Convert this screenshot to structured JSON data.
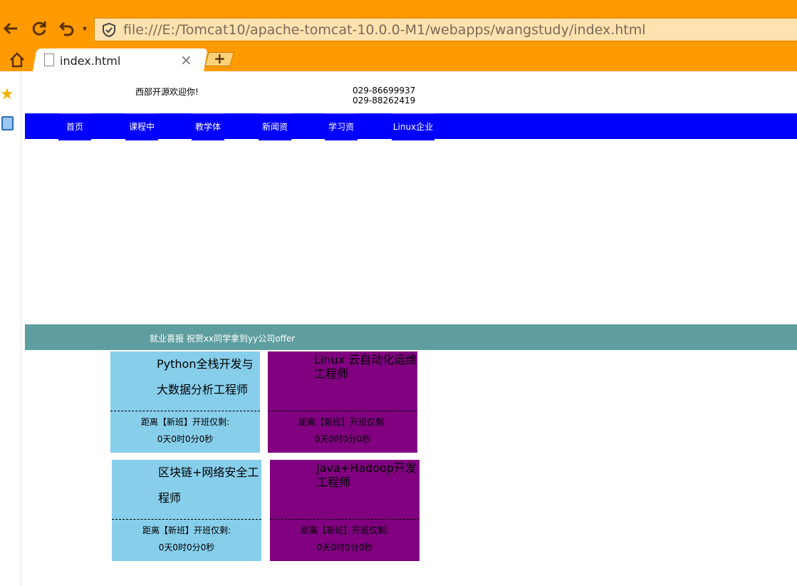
{
  "browser": {
    "url": "file:///E:/Tomcat10/apache-tomcat-10.0.0-M1/webapps/wangstudy/index.html",
    "tab_title": "index.html",
    "new_tab_label": "+",
    "accent_color": "#ff9b00"
  },
  "header": {
    "welcome": "西部开源欢迎你!",
    "phone": "029-86699937 029-88262419"
  },
  "nav": {
    "items": [
      {
        "label": "首页"
      },
      {
        "label": "课程中"
      },
      {
        "label": "教学体"
      },
      {
        "label": "新闻资"
      },
      {
        "label": "学习资"
      },
      {
        "label": "Linux企业"
      }
    ]
  },
  "banner": {
    "text": "就业喜报   祝贺xx同学拿到yy公司offer"
  },
  "courses": [
    {
      "title": "Python全栈开发与大数据分析工程师",
      "label": "距离【新班】开班仅剩:",
      "time": "0天0时0分0秒",
      "color": "#87ceeb"
    },
    {
      "title": "Linux 云自动化运维工程师",
      "label": "距离【新班】开班仅剩:",
      "time": "0天0时0分0秒",
      "color": "#800080"
    },
    {
      "title": "区块链+网络安全工程师",
      "label": "距离【新班】开班仅剩:",
      "time": "0天0时0分0秒",
      "color": "#87ceeb"
    },
    {
      "title": "Java+Hadoop开发工程师",
      "label": "距离【新班】开班仅剩:",
      "time": "0天0时0分0秒",
      "color": "#800080"
    }
  ]
}
